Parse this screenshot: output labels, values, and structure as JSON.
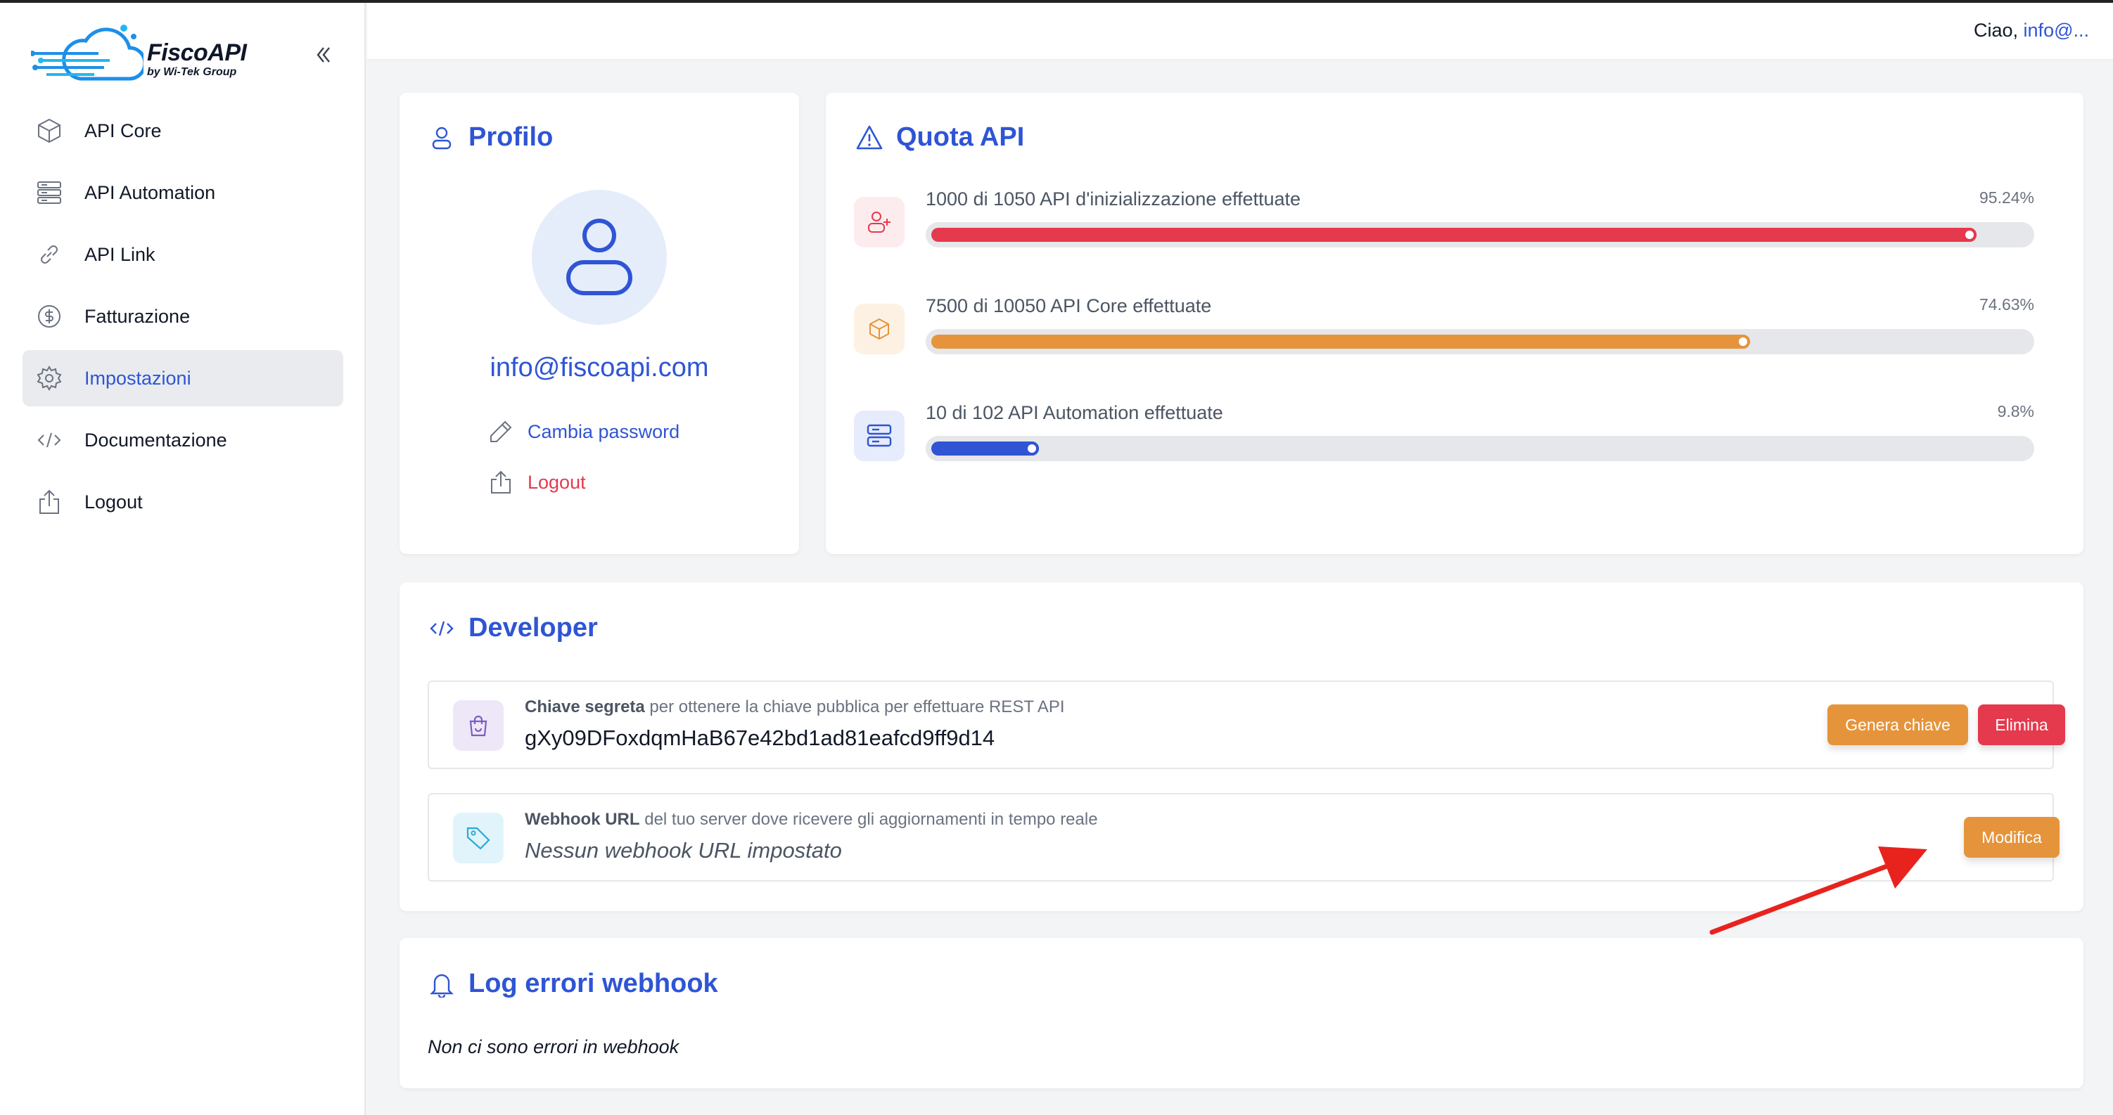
{
  "app": {
    "brand": "FiscoAPI",
    "brand_sub": "by Wi-Tek Group"
  },
  "sidebar": {
    "items": [
      {
        "label": "API Core",
        "icon": "cube-icon"
      },
      {
        "label": "API Automation",
        "icon": "server-icon"
      },
      {
        "label": "API Link",
        "icon": "link-icon"
      },
      {
        "label": "Fatturazione",
        "icon": "dollar-icon"
      },
      {
        "label": "Impostazioni",
        "icon": "gear-icon",
        "active": true
      },
      {
        "label": "Documentazione",
        "icon": "code-icon"
      },
      {
        "label": "Logout",
        "icon": "upload-icon"
      }
    ]
  },
  "header": {
    "greeting": "Ciao,",
    "user_short": "info@..."
  },
  "profile": {
    "title": "Profilo",
    "email": "info@fiscoapi.com",
    "change_password": "Cambia password",
    "logout": "Logout"
  },
  "quota": {
    "title": "Quota API",
    "rows": [
      {
        "label": "1000 di 1050 API d'inizializzazione effettuate",
        "percent_label": "95.24%",
        "percent": 95.24,
        "color": "#e5394d",
        "icon_bg": "#fdecee",
        "icon": "user-plus-icon"
      },
      {
        "label": "7500 di 10050 API Core effettuate",
        "percent_label": "74.63%",
        "percent": 74.63,
        "color": "#e5943b",
        "icon_bg": "#fdf1e4",
        "icon": "cube-icon"
      },
      {
        "label": "10 di 102 API Automation effettuate",
        "percent_label": "9.8%",
        "percent": 9.8,
        "color": "#2f55d4",
        "icon_bg": "#e6ecfb",
        "icon": "server-icon"
      }
    ]
  },
  "developer": {
    "title": "Developer",
    "secret": {
      "label_bold": "Chiave segreta",
      "label_rest": " per ottenere la chiave pubblica per effettuare REST API",
      "value": "gXy09DFoxdqmHaB67e42bd1ad81eafcd9ff9d14",
      "btn_generate": "Genera chiave",
      "btn_delete": "Elimina"
    },
    "webhook": {
      "label_bold": "Webhook URL",
      "label_rest": " del tuo server dove ricevere gli aggiornamenti in tempo reale",
      "value": "Nessun webhook URL impostato",
      "btn_edit": "Modifica"
    }
  },
  "log": {
    "title": "Log errori webhook",
    "empty": "Non ci sono errori in webhook"
  },
  "colors": {
    "accent": "#2f55d4",
    "orange": "#e5943b",
    "red": "#e5394d",
    "arrow": "#e8231e"
  }
}
